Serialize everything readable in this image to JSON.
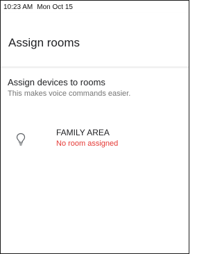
{
  "status_bar": {
    "time": "10:23 AM",
    "date": "Mon Oct 15"
  },
  "app_bar": {
    "title": "Assign rooms"
  },
  "section": {
    "title": "Assign devices to rooms",
    "subtitle": "This makes voice commands easier."
  },
  "devices": [
    {
      "icon": "lightbulb-icon",
      "name": "FAMILY AREA",
      "status": "No room assigned"
    }
  ],
  "colors": {
    "warning_text": "#e53935",
    "icon_stroke": "#5f6368"
  }
}
